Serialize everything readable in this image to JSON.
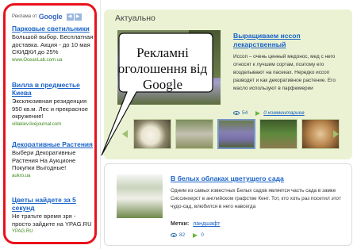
{
  "ads": {
    "header_text": "Реклама от",
    "header_brand": "Google",
    "items": [
      {
        "title": "Парковые светильники",
        "description": "Большой выбор. Бесплатная доставка. Акция - до 10 мая СКИДКИ до 25%",
        "url": "www.OceanLab.com.ua"
      },
      {
        "title": "Вилла в предместье Киева",
        "description": "Эксклюзивная резиденция 950 кв.м. Лес и прекрасное окружение!",
        "url": "villakiev.livejournal.com"
      },
      {
        "title": "Декоративные Растения",
        "description": "Выбери Декоративные Растения На Аукционе Покупки Выгодные!",
        "url": "aukro.ua"
      },
      {
        "title": "Цветы найдете за 5 секунд",
        "description": "Не тратьте время зря - просто зайдите на YPAG.RU",
        "url": "YPAG.RU"
      }
    ]
  },
  "callout": {
    "text": "Рекламні оголошення від Google"
  },
  "featured": {
    "section_title": "Актуально",
    "title": "Выращиваем иссоп лекарственный",
    "text": "Иссоп – очень ценный медонос, мед с него относят к лучшим сортам, поэтому его возделывают на пасеках. Нередко иссоп разводят и как декоративное растение. Его масло используют в парфюмерии",
    "views": "54",
    "comments_link": "0 комментариев"
  },
  "article": {
    "title": "В белых облаках цветущего сада",
    "text": "Одним из самых известных Белых садов является часть сада в замке Сиссинхерст в английском графстве Кент. Тот, кто хоть раз посетил этот чудо-сад, влюбился в него навсегда",
    "tags_label": "Метки:",
    "tag": "ландшафт",
    "views": "82",
    "comments": "0"
  },
  "colors": {
    "ad_border": "#e8121c",
    "link": "#1a63c8",
    "featured_bg": "#eaf2d3"
  }
}
